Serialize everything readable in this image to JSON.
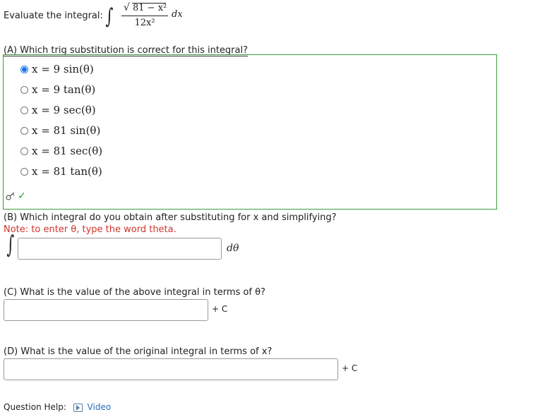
{
  "header": {
    "prompt": "Evaluate the integral:",
    "integrand_num": "81 − x²",
    "integrand_den": "12x²",
    "dx": "dx"
  },
  "part_a": {
    "question": "(A) Which trig substitution is correct for this integral?",
    "choices": [
      {
        "label": "x = 9 sin(θ)",
        "selected": true
      },
      {
        "label": "x = 9 tan(θ)",
        "selected": false
      },
      {
        "label": "x = 9 sec(θ)",
        "selected": false
      },
      {
        "label": "x = 81 sin(θ)",
        "selected": false
      },
      {
        "label": "x = 81 sec(θ)",
        "selected": false
      },
      {
        "label": "x = 81 tan(θ)",
        "selected": false
      }
    ],
    "status_icon": "check-icon",
    "status_color": "#2e9e2e"
  },
  "part_b": {
    "question": "(B) Which integral do you obtain after substituting for x and simplifying?",
    "note": "Note: to enter θ, type the word theta.",
    "input_value": "",
    "suffix": "dθ"
  },
  "part_c": {
    "question": "(C) What is the value of the above integral in terms of θ?",
    "input_value": "",
    "suffix": "+ C"
  },
  "part_d": {
    "question": "(D) What is the value of the original integral in terms of x?",
    "input_value": "",
    "suffix": "+ C"
  },
  "help": {
    "label": "Question Help:",
    "link": "Video"
  },
  "colors": {
    "correct_border": "#3c9d3c",
    "note": "#d0342c",
    "radio_selected": "#1a73e8",
    "link": "#2a6ebb"
  }
}
